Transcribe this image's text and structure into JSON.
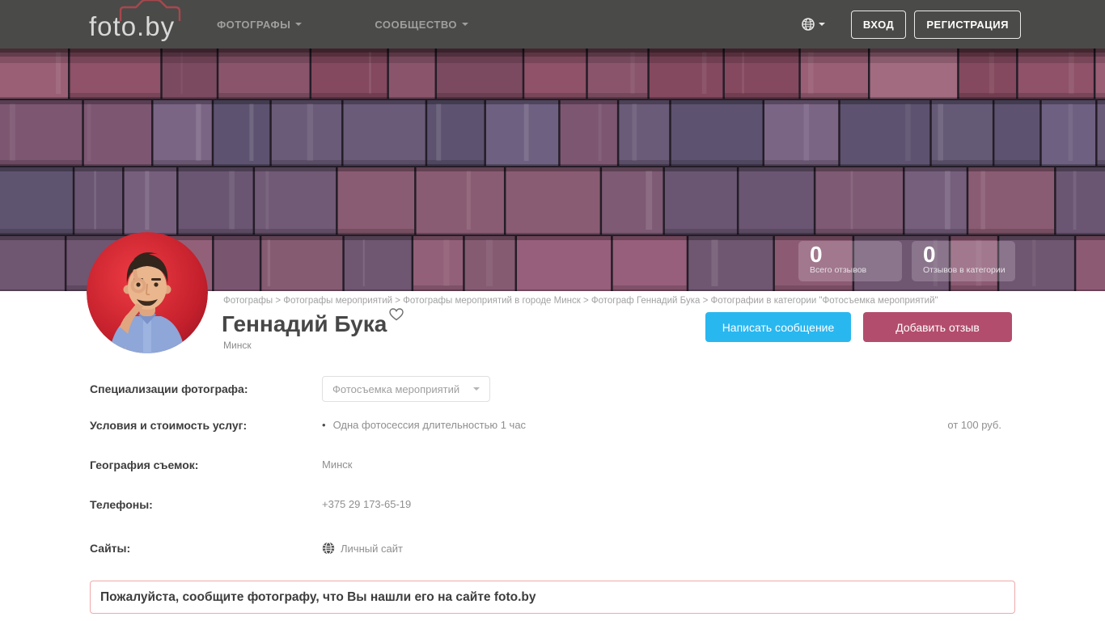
{
  "header": {
    "logo": "foto.by",
    "nav": [
      {
        "label": "ФОТОГРАФЫ"
      },
      {
        "label": "СООБЩЕСТВО"
      }
    ],
    "login_label": "ВХОД",
    "register_label": "РЕГИСТРАЦИЯ"
  },
  "hero": {
    "stats": [
      {
        "value": "0",
        "label": "Всего отзывов"
      },
      {
        "value": "0",
        "label": "Отзывов в категории"
      }
    ]
  },
  "profile": {
    "breadcrumb": "Фотографы > Фотографы мероприятий > Фотографы мероприятий в городе Минск > Фотограф Геннадий Бука > Фотографии в категории \"Фотосъемка мероприятий\"",
    "name": "Геннадий Бука",
    "city": "Минск",
    "message_button": "Написать сообщение",
    "review_button": "Добавить отзыв"
  },
  "details": {
    "specializations_label": "Специализации фотографа:",
    "specialization_selected": "Фотосъемка мероприятий",
    "services_label": "Условия и стоимость услуг:",
    "service_item": "Одна фотосессия длительностью 1 час",
    "service_price": "от 100 руб.",
    "geography_label": "География съемок:",
    "geography_value": "Минск",
    "phones_label": "Телефоны:",
    "phone_value": "+375 29 173-65-19",
    "sites_label": "Сайты:",
    "site_link": "Личный сайт"
  },
  "notice": {
    "text": "Пожалуйста, сообщите фотографу, что Вы нашли его на сайте foto.by"
  },
  "colors": {
    "accent_blue": "#29b7f0",
    "accent_rose": "#b24d6d",
    "header_bg": "#4a4a48"
  }
}
